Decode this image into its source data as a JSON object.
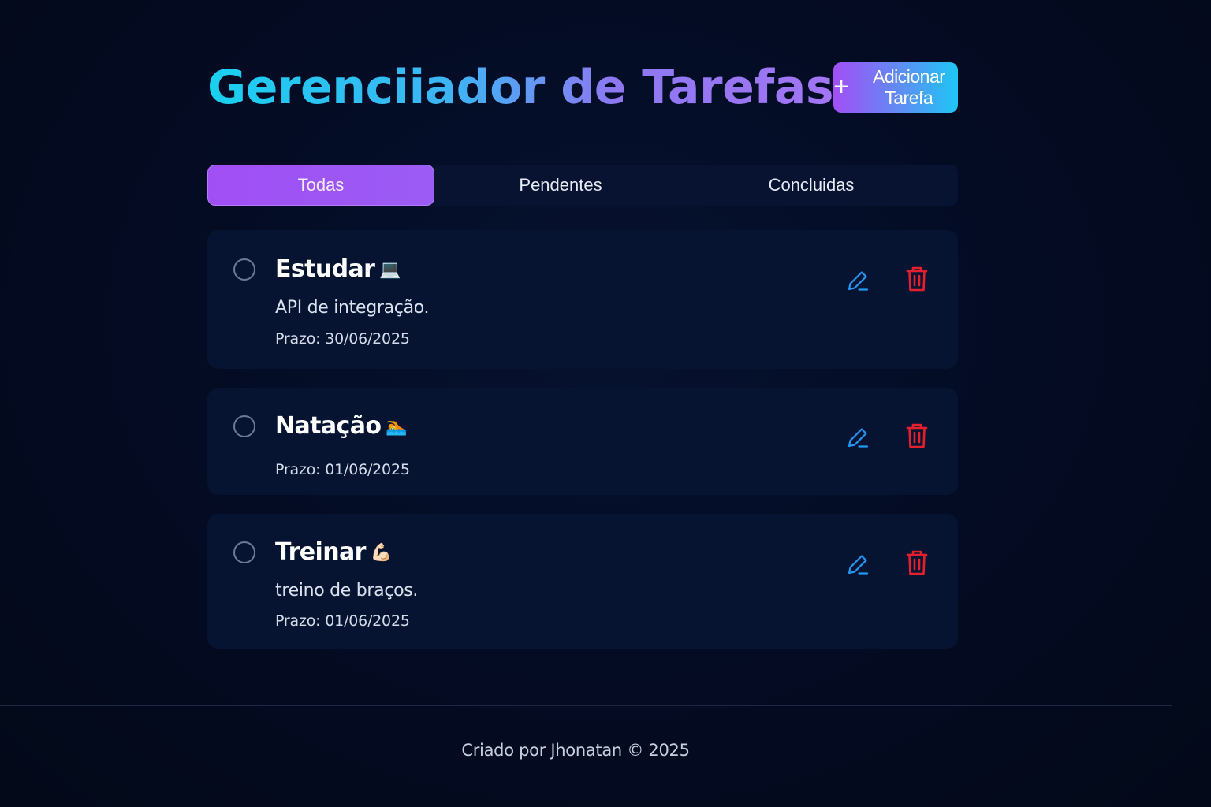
{
  "header": {
    "title": "Gerenciiador de Tarefas",
    "add_button_label": "Adicionar Tarefa",
    "add_button_icon": "plus-icon"
  },
  "tabs": [
    {
      "label": "Todas",
      "active": true
    },
    {
      "label": "Pendentes",
      "active": false
    },
    {
      "label": "Concluidas",
      "active": false
    }
  ],
  "tasks": [
    {
      "title": "Estudar",
      "emoji": "💻",
      "description": "API de integração.",
      "due": "Prazo: 30/06/2025",
      "done": false
    },
    {
      "title": "Natação",
      "emoji": "🏊",
      "description": "",
      "due": "Prazo: 01/06/2025",
      "done": false
    },
    {
      "title": "Treinar",
      "emoji": "💪🏻",
      "description": "treino de braços.",
      "due": "Prazo: 01/06/2025",
      "done": false
    }
  ],
  "icons": {
    "edit": "pencil-icon",
    "delete": "trash-icon"
  },
  "colors": {
    "accent_purple": "#a04ff5",
    "accent_cyan": "#1dc6f4",
    "edit_blue": "#2196f3",
    "delete_red": "#e5202e"
  },
  "footer": {
    "text": "Criado por Jhonatan © 2025"
  }
}
